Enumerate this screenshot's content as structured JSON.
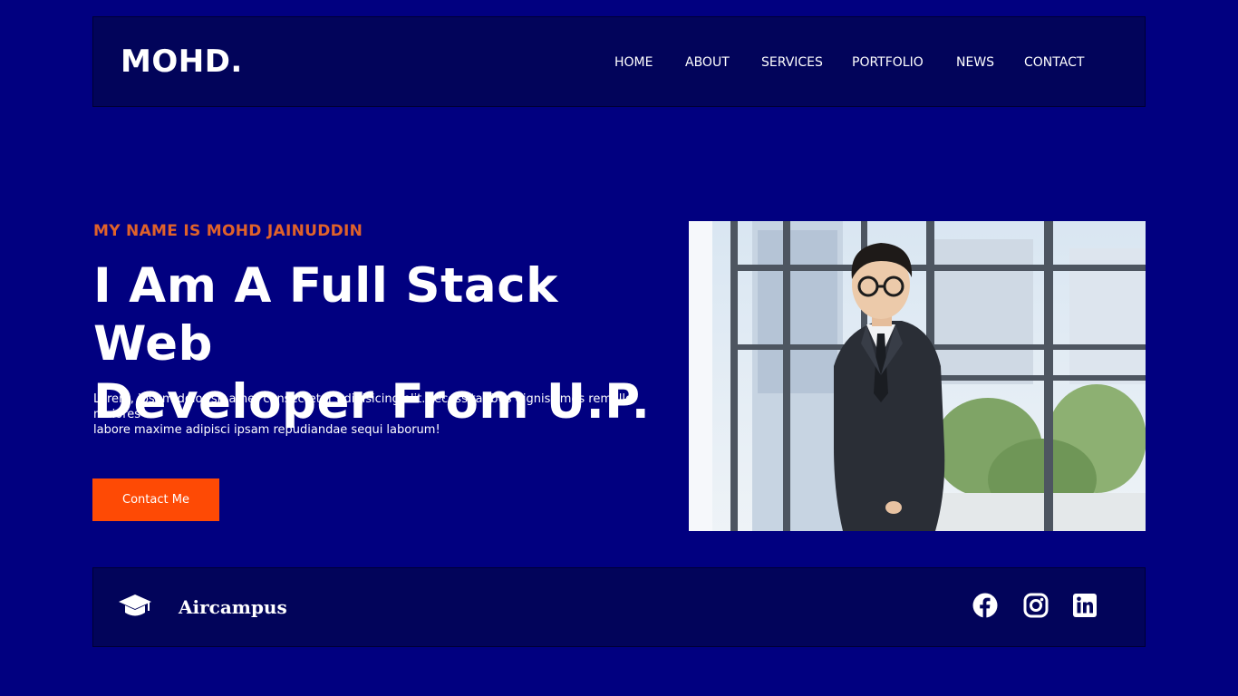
{
  "header": {
    "logo": "MOHD.",
    "nav": [
      {
        "label": "HOME"
      },
      {
        "label": "ABOUT"
      },
      {
        "label": "SERVICES"
      },
      {
        "label": "PORTFOLIO"
      },
      {
        "label": "NEWS"
      },
      {
        "label": "CONTACT"
      }
    ]
  },
  "hero": {
    "subtitle": "MY NAME IS MOHD JAINUDDIN",
    "title_line1": "I Am A Full Stack Web",
    "title_line2": "Developer From U.P.",
    "description_line1": "Lorem, ipsum dolor sit amet consectetur adipisicing elit.Necessitatibus dignissimos rem illo maiores",
    "description_line2": "labore maxime adipisci ipsam repudiandae sequi laborum!",
    "cta_label": "Contact Me",
    "photo_icon": "profile-photo"
  },
  "footer": {
    "brand_icon": "graduation-cap-icon",
    "brand_name": "Aircampus",
    "socials": [
      {
        "icon": "facebook-icon"
      },
      {
        "icon": "instagram-icon"
      },
      {
        "icon": "linkedin-icon"
      }
    ]
  },
  "colors": {
    "background": "#010080",
    "bar_background": "#02045a",
    "accent_subtitle": "#e0622a",
    "button": "#fe4a05",
    "text": "#ffffff"
  }
}
